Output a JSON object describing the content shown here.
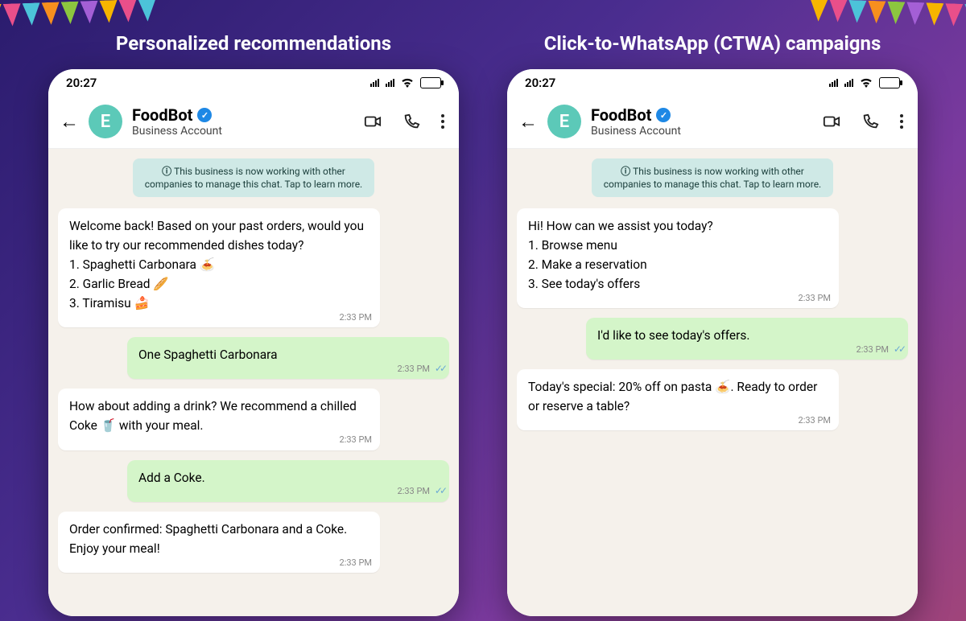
{
  "titles": {
    "left": "Personalized recommendations",
    "right": "Click-to-WhatsApp (CTWA) campaigns"
  },
  "status": {
    "time": "20:27"
  },
  "contact": {
    "name": "FoodBot",
    "sub": "Business Account",
    "avatar_letter": "E"
  },
  "info_banner": "This business is now working with other companies to manage this chat. Tap to learn more.",
  "timestamps": {
    "t": "2:33 PM"
  },
  "left_chat": {
    "m1": "Welcome back! Based on your past orders, would you like to try our recommended dishes today?\n1. Spaghetti Carbonara 🍝\n2. Garlic Bread 🥖\n3. Tiramisu 🍰",
    "m2": "One Spaghetti Carbonara",
    "m3": "How about adding a drink? We recommend a chilled Coke 🥤 with your meal.",
    "m4": "Add a Coke.",
    "m5": "Order confirmed: Spaghetti Carbonara and a Coke. Enjoy your meal!"
  },
  "right_chat": {
    "m1": "Hi! How can we assist you today?\n1. Browse menu\n2. Make a reservation\n3. See today's offers",
    "m2": "I'd like to see today's offers.",
    "m3": "Today's special: 20% off on pasta 🍝. Ready to order or reserve a table?"
  }
}
